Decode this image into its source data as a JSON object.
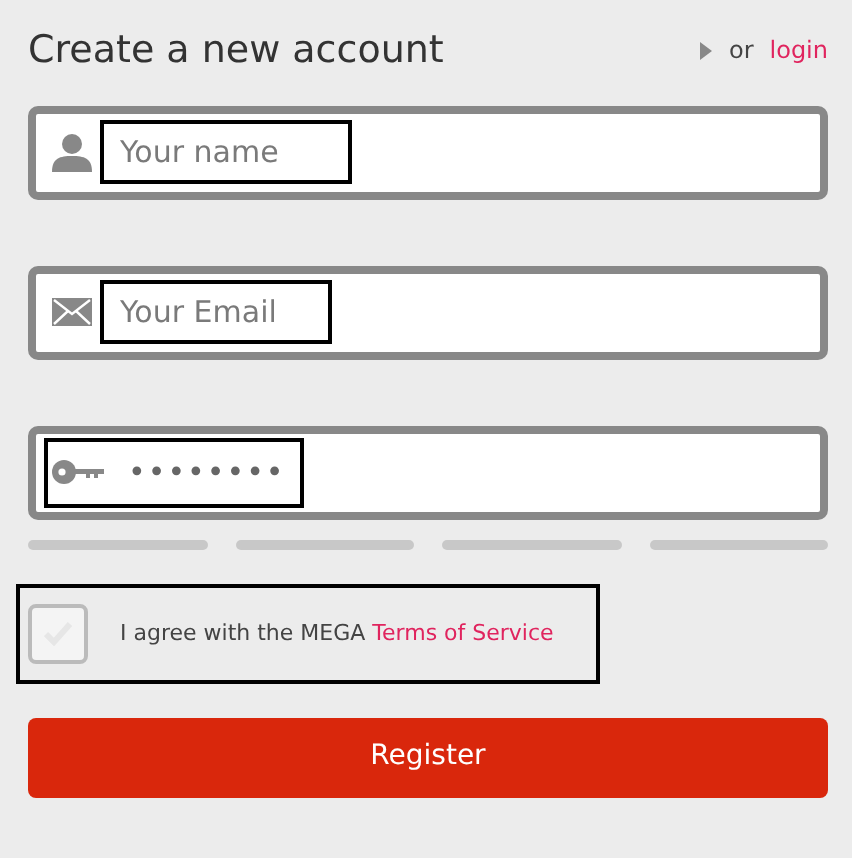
{
  "heading": "Create a new account",
  "login_prompt": {
    "prefix": "or",
    "link": "login"
  },
  "fields": [
    {
      "kind": "name",
      "placeholder": "Your name",
      "highlighted": true
    },
    {
      "kind": "email",
      "placeholder": "Your Email",
      "highlighted": true
    },
    {
      "kind": "password",
      "value": "••••••••",
      "highlighted": true
    }
  ],
  "terms": {
    "checked": false,
    "text": "I agree with the MEGA",
    "link": "Terms of Service",
    "highlighted": true
  },
  "buttons": [
    "Register"
  ]
}
